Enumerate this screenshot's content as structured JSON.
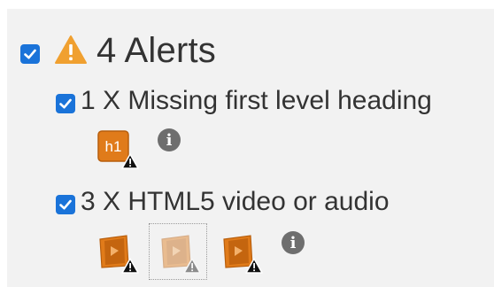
{
  "alerts_header": {
    "count_label": "4 Alerts",
    "checked": true,
    "icon": "warning-triangle-icon"
  },
  "alert_items": [
    {
      "label": "1 X Missing first level heading",
      "checked": true,
      "icons": [
        {
          "name": "heading-h1-alert-icon",
          "text": "h1"
        }
      ],
      "info_icon": "info-icon"
    },
    {
      "label": "3 X HTML5 video or audio",
      "checked": true,
      "icons": [
        {
          "name": "video-alert-icon"
        },
        {
          "name": "video-alert-icon-selected"
        },
        {
          "name": "video-alert-icon"
        }
      ],
      "info_icon": "info-icon"
    }
  ],
  "colors": {
    "checkbox": "#1a73d9",
    "warning": "#f0a030",
    "tile": "#e07b1a",
    "info": "#6e6e6e"
  }
}
